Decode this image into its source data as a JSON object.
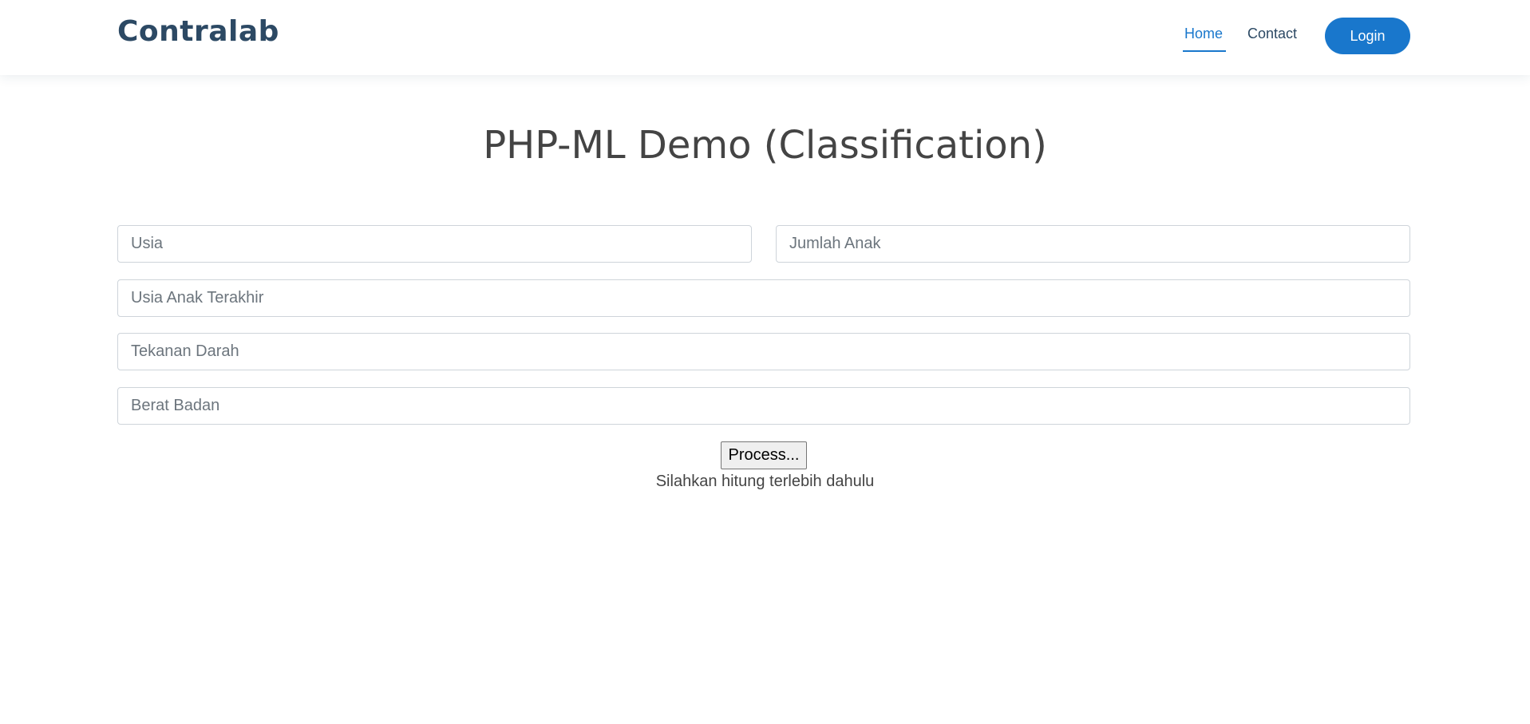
{
  "header": {
    "logo": "Contralab",
    "nav": [
      {
        "label": "Home",
        "active": true
      },
      {
        "label": "Contact",
        "active": false
      }
    ],
    "login_label": "Login"
  },
  "main": {
    "title": "PHP-ML Demo (Classification)",
    "fields": {
      "usia": {
        "placeholder": "Usia",
        "value": ""
      },
      "jumlah_anak": {
        "placeholder": "Jumlah Anak",
        "value": ""
      },
      "usia_anak_terakhir": {
        "placeholder": "Usia Anak Terakhir",
        "value": ""
      },
      "tekanan_darah": {
        "placeholder": "Tekanan Darah",
        "value": ""
      },
      "berat_badan": {
        "placeholder": "Berat Badan",
        "value": ""
      }
    },
    "process_label": "Process...",
    "result_text": "Silahkan hitung terlebih dahulu"
  },
  "colors": {
    "accent": "#1977cc",
    "logo": "#2c4964",
    "text": "#444444"
  }
}
